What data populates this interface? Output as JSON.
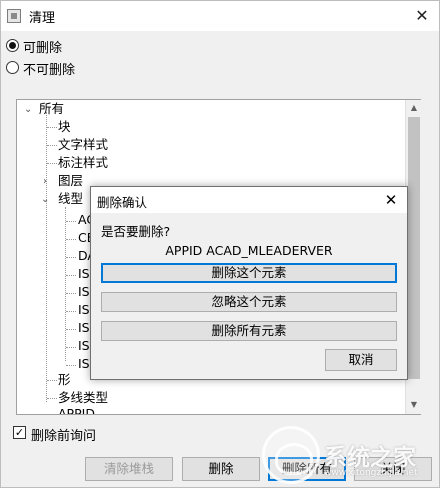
{
  "window": {
    "title": "清理",
    "close_glyph": "✕"
  },
  "options": {
    "purgeable_label": "可删除",
    "non_purgeable_label": "不可删除"
  },
  "tree": {
    "root": "所有",
    "items": {
      "block": "块",
      "text_style": "文字样式",
      "dim_style": "标注样式",
      "layer": "图层",
      "linetype": "线型",
      "shape": "形",
      "mline_style": "多线类型",
      "regapp": "APPID"
    },
    "linetype_children": [
      "AC",
      "CE",
      "DA",
      "ISC",
      "ISC",
      "ISC",
      "ISC",
      "ISC",
      "ISC"
    ]
  },
  "confirm_checkbox": {
    "checked": "✓",
    "label": "删除前询问"
  },
  "buttons": {
    "clear_unused": "清除堆栈",
    "purge": "删除",
    "purge_all": "删除所有",
    "close": "关闭"
  },
  "dialog": {
    "title": "删除确认",
    "close_glyph": "✕",
    "question": "是否要删除?",
    "item_name": "APPID ACAD_MLEADERVER",
    "purge_this": "删除这个元素",
    "skip_this": "忽略这个元素",
    "purge_all": "删除所有元素",
    "cancel": "取消"
  },
  "watermark": {
    "text": "系统之家",
    "url": "www.xitongzhijia.net"
  }
}
